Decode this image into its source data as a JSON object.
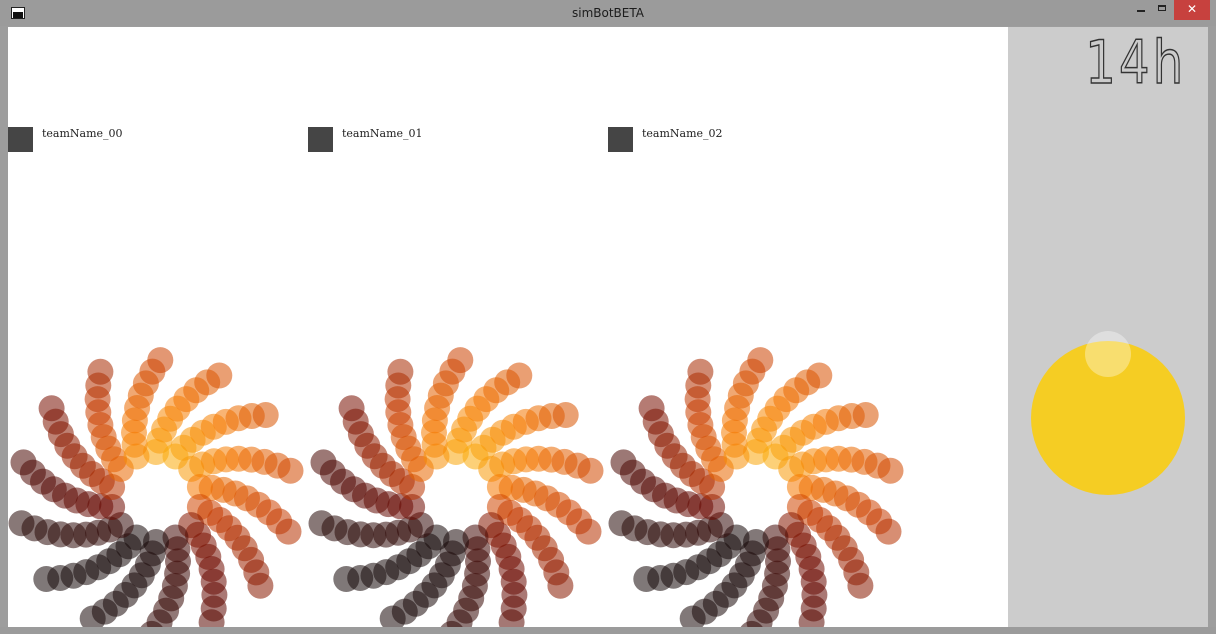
{
  "window": {
    "title": "simBotBETA"
  },
  "teams": [
    {
      "name": "teamName_00"
    },
    {
      "name": "teamName_01"
    },
    {
      "name": "teamName_02"
    }
  ],
  "side_panel": {
    "clock_text": "14h"
  },
  "colors": {
    "team_swatch": "#454545",
    "sun": "#f5cd23",
    "side_panel_bg": "#cccccc",
    "canvas_bg": "#ffffff",
    "close_button": "#c7413e"
  },
  "icons": {
    "minimize": "minimize-icon",
    "maximize": "maximize-icon",
    "close": "close-icon",
    "app": "app-icon"
  }
}
